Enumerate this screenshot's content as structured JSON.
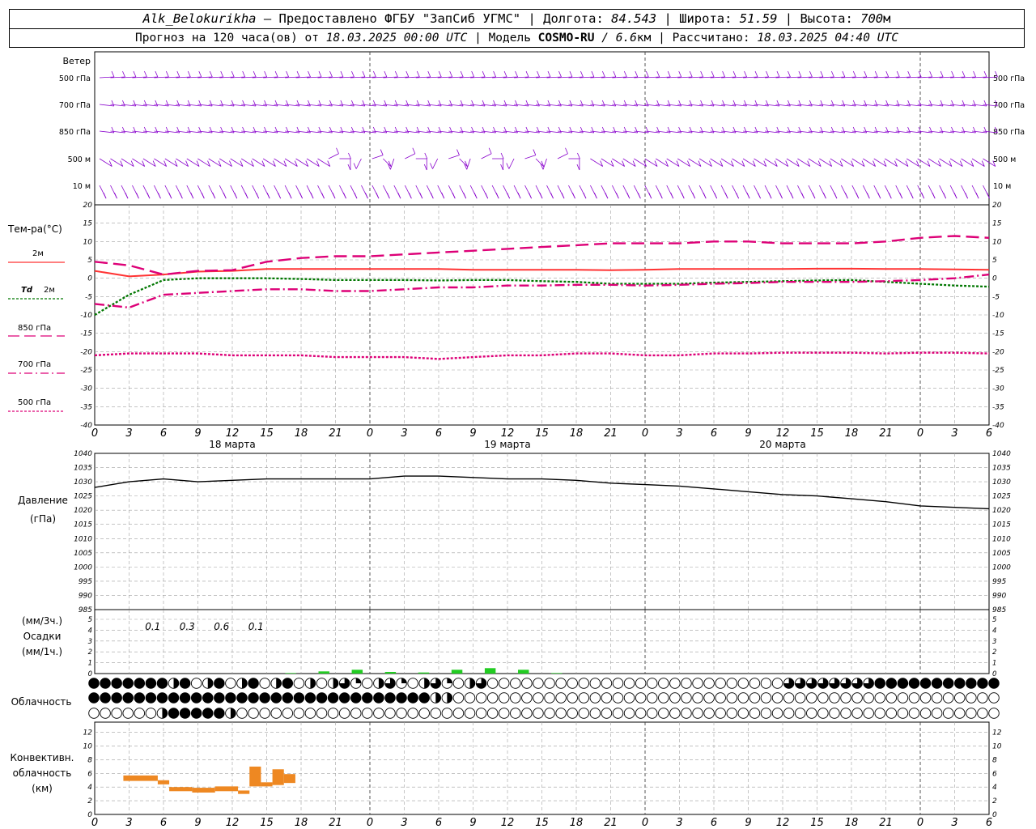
{
  "header": {
    "station": "Alk_Belokurikha",
    "provider": " – Предоставлено ФГБУ \"ЗапСиб УГМС\"",
    "lon_label": "Долгота:",
    "lon_value": "84.543",
    "lat_label": "Широта:",
    "lat_value": "51.59",
    "alt_label": "Высота:",
    "alt_value": "700",
    "alt_unit": "м",
    "sep": " | ",
    "forecast_label": "Прогноз на 120 часа(ов) от ",
    "forecast_start": "18.03.2025 00:00 UTC",
    "model_label": "Модель ",
    "model_name": "COSMO-RU",
    "model_res": " / 6.6",
    "model_res_unit": "км",
    "calc_label": "Рассчитано: ",
    "calc_time": "18.03.2025 04:40 UTC"
  },
  "colors": {
    "grid": "#a0a0a0",
    "t2m": "#ff3333",
    "td2m": "#007700",
    "t850": "#dd0077",
    "t700": "#dd0077",
    "t500": "#dd0077",
    "wind": "#8800cc",
    "pressure": "#000000",
    "precip": "#22cc22",
    "conv": "#ee8822"
  },
  "time_axis": {
    "tick_labels": [
      "0",
      "3",
      "6",
      "9",
      "12",
      "15",
      "18",
      "21",
      "0",
      "3",
      "6",
      "9",
      "12",
      "15",
      "18",
      "21",
      "0",
      "3",
      "6",
      "9",
      "12",
      "15",
      "18",
      "21",
      "0",
      "3",
      "6"
    ],
    "day_labels": [
      "18 марта",
      "19 марта",
      "20 марта"
    ]
  },
  "wind_panel": {
    "title": "Ветер",
    "levels": [
      "500 гПа",
      "700 гПа",
      "850 гПа",
      "500 м",
      "10  м"
    ]
  },
  "temp_panel": {
    "title": "Тем-ра(°C)",
    "legend": {
      "t2m": "2м",
      "td_sym": "Td",
      "td_lvl": "2м",
      "t850": "850 гПа",
      "t700": "700 гПа",
      "t500": "500 гПа"
    },
    "ticks_left": [
      "20",
      "15",
      "10",
      "5",
      "0",
      "-5",
      "-10",
      "-15",
      "-20",
      "-25",
      "-30",
      "-35",
      "-40"
    ],
    "ticks_right": [
      "20",
      "15",
      "10",
      "5",
      "0",
      "-5",
      "-10",
      "-15",
      "-20",
      "-25",
      "-30",
      "-35",
      "-40"
    ]
  },
  "pressure_panel": {
    "title1": "Давление",
    "title2": "(гПа)",
    "ticks": [
      "1040",
      "1035",
      "1030",
      "1025",
      "1020",
      "1015",
      "1010",
      "1005",
      "1000",
      "995",
      "990",
      "985"
    ]
  },
  "precip_panel": {
    "title1": "(мм/3ч.)",
    "title2": "Осадки",
    "title3": "(мм/1ч.)",
    "ticks": [
      "5",
      "4",
      "3",
      "2",
      "1",
      "0"
    ],
    "totals": [
      "0.1",
      "0.3",
      "0.6",
      "0.1"
    ]
  },
  "cloud_panel": {
    "title": "Облачность"
  },
  "conv_panel": {
    "title1": "Конвективн.",
    "title2": "облачность",
    "title3": "(км)",
    "ticks": [
      "12",
      "10",
      "8",
      "6",
      "4",
      "2",
      "0"
    ]
  },
  "chart_data": [
    {
      "type": "line",
      "title": "Тем-ра(°C)",
      "ylim": [
        -40,
        20
      ],
      "x": [
        0,
        3,
        6,
        9,
        12,
        15,
        18,
        21,
        24,
        27,
        30,
        33,
        36,
        39,
        42,
        45,
        48,
        51,
        54,
        57,
        60,
        63,
        66,
        69,
        72,
        75,
        78
      ],
      "series": [
        {
          "name": "2м",
          "values": [
            2,
            0.5,
            1,
            1.8,
            2,
            2.5,
            2.5,
            2.5,
            2.5,
            2.5,
            2.5,
            2.3,
            2.3,
            2.3,
            2.3,
            2.2,
            2.3,
            2.5,
            2.5,
            2.5,
            2.5,
            2.6,
            2.6,
            2.5,
            2.5,
            2.4,
            2.3
          ]
        },
        {
          "name": "Td 2м",
          "values": [
            -10,
            -4.5,
            -0.5,
            0,
            0,
            0,
            -0.2,
            -0.5,
            -0.5,
            -0.5,
            -0.6,
            -0.5,
            -0.5,
            -0.8,
            -1,
            -1.5,
            -1.5,
            -1.5,
            -1.2,
            -1,
            -0.8,
            -0.6,
            -0.5,
            -1,
            -1.5,
            -2,
            -2.3
          ]
        },
        {
          "name": "850 гПа",
          "values": [
            4.5,
            3.5,
            1,
            2,
            2.2,
            4.5,
            5.5,
            6,
            6,
            6.5,
            7,
            7.5,
            8,
            8.5,
            9,
            9.5,
            9.5,
            9.5,
            10,
            10,
            9.5,
            9.5,
            9.5,
            10,
            11,
            11.5,
            11
          ]
        },
        {
          "name": "700 гПа",
          "values": [
            -7,
            -8,
            -4.5,
            -4,
            -3.5,
            -3,
            -3,
            -3.5,
            -3.5,
            -3,
            -2.5,
            -2.5,
            -2,
            -2,
            -1.8,
            -1.8,
            -2,
            -1.8,
            -1.5,
            -1.3,
            -1,
            -1,
            -1,
            -0.8,
            -0.5,
            0,
            1
          ]
        },
        {
          "name": "500 гПа",
          "values": [
            -21,
            -20.5,
            -20.5,
            -20.5,
            -21,
            -21,
            -21,
            -21.5,
            -21.5,
            -21.5,
            -22,
            -21.5,
            -21,
            -21,
            -20.5,
            -20.5,
            -21,
            -21,
            -20.5,
            -20.5,
            -20.3,
            -20.3,
            -20.3,
            -20.5,
            -20.3,
            -20.3,
            -20.5
          ]
        }
      ]
    },
    {
      "type": "line",
      "title": "Давление (гПа)",
      "ylim": [
        985,
        1040
      ],
      "x": [
        0,
        3,
        6,
        9,
        12,
        15,
        18,
        21,
        24,
        27,
        30,
        33,
        36,
        39,
        42,
        45,
        48,
        51,
        54,
        57,
        60,
        63,
        66,
        69,
        72,
        75,
        78
      ],
      "series": [
        {
          "name": "",
          "values": [
            1028,
            1030,
            1031,
            1030,
            1030.5,
            1031,
            1031,
            1031,
            1031,
            1032,
            1032,
            1031.5,
            1031,
            1031,
            1030.5,
            1029.5,
            1029,
            1028.5,
            1027.5,
            1026.5,
            1025.5,
            1025,
            1024,
            1023,
            1021.5,
            1021,
            1020.5
          ]
        }
      ]
    },
    {
      "type": "bar",
      "title": "Осадки",
      "ylim": [
        0,
        5
      ],
      "x": [
        5,
        6,
        7,
        8,
        9,
        10,
        11,
        12,
        13
      ],
      "values": [
        0.05,
        0.2,
        0.35,
        0.15,
        0.1,
        0.35,
        0.5,
        0.35,
        0.05
      ],
      "annotations": [
        "0.1",
        "0.3",
        "0.6",
        "0.1"
      ]
    },
    {
      "type": "bar",
      "title": "Конвективн. облачность (км)",
      "ylim": [
        0,
        13
      ],
      "segments": [
        {
          "x0": 2.5,
          "x1": 5.5,
          "bottom": 4.9,
          "top": 5.7
        },
        {
          "x0": 5.5,
          "x1": 6.5,
          "bottom": 4.4,
          "top": 5.0
        },
        {
          "x0": 6.5,
          "x1": 8.5,
          "bottom": 3.4,
          "top": 4.0
        },
        {
          "x0": 8.5,
          "x1": 10.5,
          "bottom": 3.2,
          "top": 3.9
        },
        {
          "x0": 10.5,
          "x1": 12.5,
          "bottom": 3.4,
          "top": 4.1
        },
        {
          "x0": 12.5,
          "x1": 13.5,
          "bottom": 3.0,
          "top": 3.5
        },
        {
          "x0": 13.5,
          "x1": 14.5,
          "bottom": 4.1,
          "top": 7.0
        },
        {
          "x0": 14.5,
          "x1": 15.5,
          "bottom": 4.1,
          "top": 4.7
        },
        {
          "x0": 15.5,
          "x1": 16.5,
          "bottom": 4.3,
          "top": 6.6
        },
        {
          "x0": 16.5,
          "x1": 17.5,
          "bottom": 4.6,
          "top": 5.9
        }
      ]
    }
  ]
}
